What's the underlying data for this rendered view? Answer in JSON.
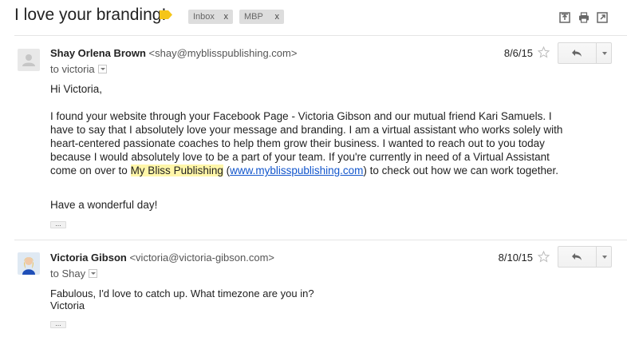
{
  "thread": {
    "subject": "I love your branding!",
    "labels": [
      {
        "name": "Inbox",
        "remove": "x"
      },
      {
        "name": "MBP",
        "remove": "x"
      }
    ],
    "header_icons": [
      "expand-all-icon",
      "print-icon",
      "new-window-icon"
    ],
    "tag_color": "#f5c518"
  },
  "messages": [
    {
      "sender_name": "Shay Orlena Brown",
      "sender_email": "<shay@myblisspublishing.com>",
      "to": "to victoria",
      "date": "8/6/15",
      "greeting": "Hi Victoria,",
      "paragraph": {
        "before_highlight": "I found your website through your Facebook Page - Victoria Gibson and our mutual friend Kari Samuels. I have to say that I absolutely love your message and branding. I am a virtual assistant who works solely with heart-centered passionate coaches to help them grow their business. I wanted to reach out to you today because I would absolutely love to be a part of your team. If you're currently in need of a Virtual Assistant come on over to ",
        "highlight": "My Bliss Publishing",
        "open_paren": " (",
        "link": "www.myblisspublishing.com",
        "after_link": ") to check out how we can work together."
      },
      "closing": "Have a wonderful day!",
      "trimmed_label": "..."
    },
    {
      "sender_name": "Victoria Gibson",
      "sender_email": "<victoria@victoria-gibson.com>",
      "to": "to Shay",
      "date": "8/10/15",
      "line1": "Fabulous, I'd love to catch up. What timezone are you in?",
      "line2": "Victoria",
      "trimmed_label": "..."
    }
  ]
}
